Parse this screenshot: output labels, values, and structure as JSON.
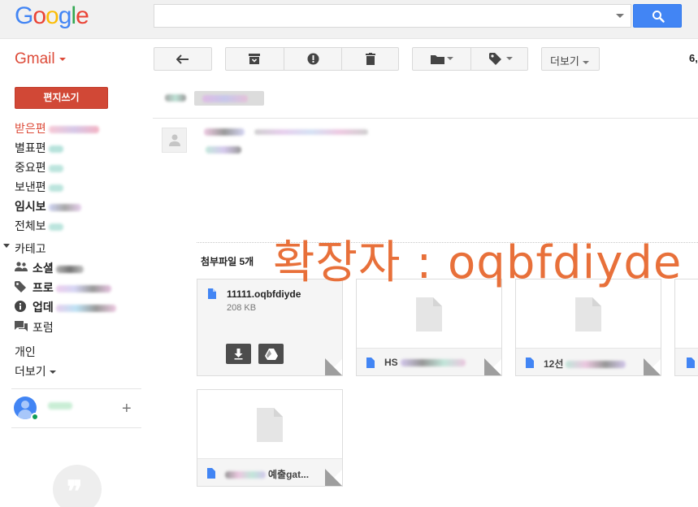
{
  "brand": {
    "logo_letters": [
      "G",
      "o",
      "o",
      "g",
      "l",
      "e"
    ],
    "logo_colors": [
      "#4285f4",
      "#ea4335",
      "#fbbc05",
      "#4285f4",
      "#34a853",
      "#ea4335"
    ],
    "gmail_label": "Gmail"
  },
  "search": {
    "placeholder": "",
    "button_icon": "search-icon"
  },
  "toolbar": {
    "icons": [
      "reply-icon",
      "archive-icon",
      "report-spam-icon",
      "delete-icon",
      "folder-icon",
      "label-icon"
    ],
    "more_label": "더보기",
    "count_label": "6,"
  },
  "sidebar": {
    "compose_label": "편지쓰기",
    "folders": [
      {
        "label": "받은편",
        "active": true,
        "bold": false
      },
      {
        "label": "별표편",
        "active": false,
        "bold": false
      },
      {
        "label": "중요편",
        "active": false,
        "bold": false
      },
      {
        "label": "보낸편",
        "active": false,
        "bold": false
      },
      {
        "label": "임시보",
        "active": false,
        "bold": true
      },
      {
        "label": "전체보",
        "active": false,
        "bold": false
      }
    ],
    "category_label": "카테고",
    "categories": [
      {
        "icon": "people-icon",
        "label": "소셜",
        "bold": true
      },
      {
        "icon": "tag-icon",
        "label": "프로",
        "bold": true
      },
      {
        "icon": "info-icon",
        "label": "업데",
        "bold": true
      },
      {
        "icon": "forum-icon",
        "label": "포럼",
        "bold": false
      }
    ],
    "personal_label": "개인",
    "more_label": "더보기"
  },
  "message": {
    "attachments_title": "첨부파일 5개",
    "watermark": "확장자 : oqbfdiyde",
    "attachments": [
      {
        "name": "11111.oqbfdiyde",
        "size": "208 KB"
      },
      {
        "name": "HS"
      },
      {
        "name": "12선"
      },
      {
        "name": ""
      },
      {
        "name": "예출gat..."
      }
    ]
  },
  "colors": {
    "accent_red": "#dd4b39",
    "compose_bg": "#d14836",
    "search_blue": "#4285f4",
    "watermark": "#e8703a"
  }
}
